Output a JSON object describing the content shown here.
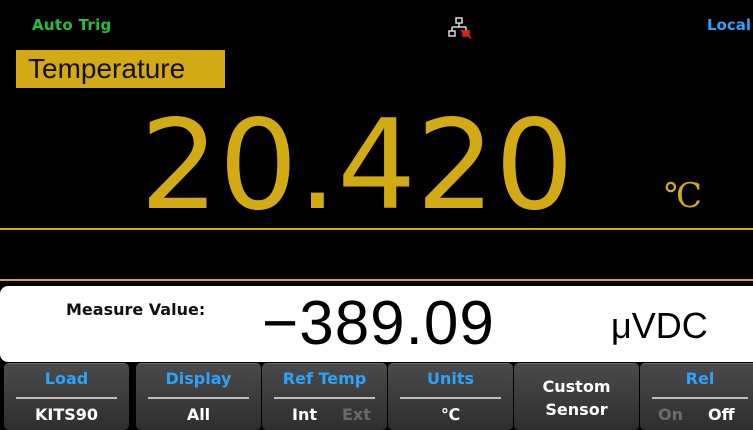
{
  "status_bar": {
    "trigger": "Auto Trig",
    "network_icon": "lan-disconnected-icon",
    "remote_state": "Local"
  },
  "primary": {
    "function_label": "Temperature",
    "value": "20.420",
    "unit": "℃"
  },
  "secondary": {
    "label": "Measure Value:",
    "value": "−389.09",
    "unit": "μVDC"
  },
  "softkeys": [
    {
      "title": "Load",
      "value": "KITS90"
    },
    {
      "title": "Display",
      "value": "All"
    },
    {
      "title": "Ref Temp",
      "options": [
        "Int",
        "Ext"
      ],
      "selected": "Int"
    },
    {
      "title": "Units",
      "value": "℃"
    },
    {
      "label_line1": "Custom",
      "label_line2": "Sensor"
    },
    {
      "title": "Rel",
      "options": [
        "On",
        "Off"
      ],
      "selected": "Off"
    }
  ],
  "colors": {
    "background": "#000000",
    "accent": "#d4aa14",
    "trigger_text": "#1fc23a",
    "softkey_title": "#2aa3ff"
  }
}
